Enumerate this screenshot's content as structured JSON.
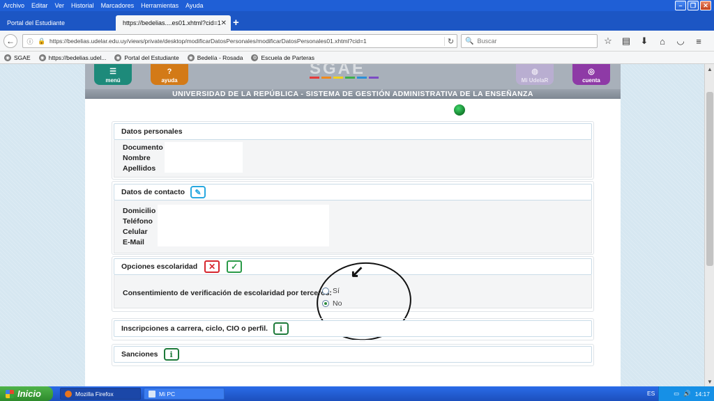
{
  "browser": {
    "menu": [
      "Archivo",
      "Editar",
      "Ver",
      "Historial",
      "Marcadores",
      "Herramientas",
      "Ayuda"
    ],
    "tabs": [
      {
        "label": "Portal del Estudiante",
        "active": false
      },
      {
        "label": "https://bedelias....es01.xhtml?cid=1",
        "active": true
      }
    ],
    "url": "https://bedelias.udelar.edu.uy/views/private/desktop/modificarDatosPersonales/modificarDatosPersonales01.xhtml?cid=1",
    "search_placeholder": "Buscar",
    "bookmarks": [
      "SGAE",
      "https://bedelias.udel...",
      "Portal del Estudiante",
      "Bedelía - Rosada",
      "Escuela de Parteras"
    ]
  },
  "header": {
    "tiles": {
      "menu": "menú",
      "ayuda": "ayuda",
      "uy": "Mi UdelaR",
      "cuenta": "cuenta"
    },
    "logo": "SGAE",
    "band": "UNIVERSIDAD DE LA REPÚBLICA - SISTEMA DE GESTIÓN ADMINISTRATIVA DE LA ENSEÑANZA",
    "logo_bar_colors": [
      "#e63a3a",
      "#f08a1c",
      "#f3d21a",
      "#3fb04a",
      "#2a8fd8",
      "#7c4bc4"
    ]
  },
  "panels": {
    "personal": {
      "title": "Datos personales",
      "fields": [
        "Documento",
        "Nombre",
        "Apellidos"
      ]
    },
    "contact": {
      "title": "Datos de contacto",
      "fields": [
        "Domicilio",
        "Teléfono",
        "Celular",
        "E-Mail"
      ]
    },
    "schooling": {
      "title": "Opciones escolaridad",
      "consent_label": "Consentimiento de verificación de escolaridad por terceros:",
      "options": [
        {
          "label": "Sí",
          "checked": false
        },
        {
          "label": "No",
          "checked": true
        }
      ]
    },
    "enrollments": {
      "title": "Inscripciones a carrera, ciclo, CIO o perfil."
    },
    "sanctions": {
      "title": "Sanciones"
    }
  },
  "taskbar": {
    "start": "Inicio",
    "tasks": [
      "Mozilla Firefox",
      "Mi PC"
    ],
    "lang": "ES",
    "clock": "14:17"
  }
}
